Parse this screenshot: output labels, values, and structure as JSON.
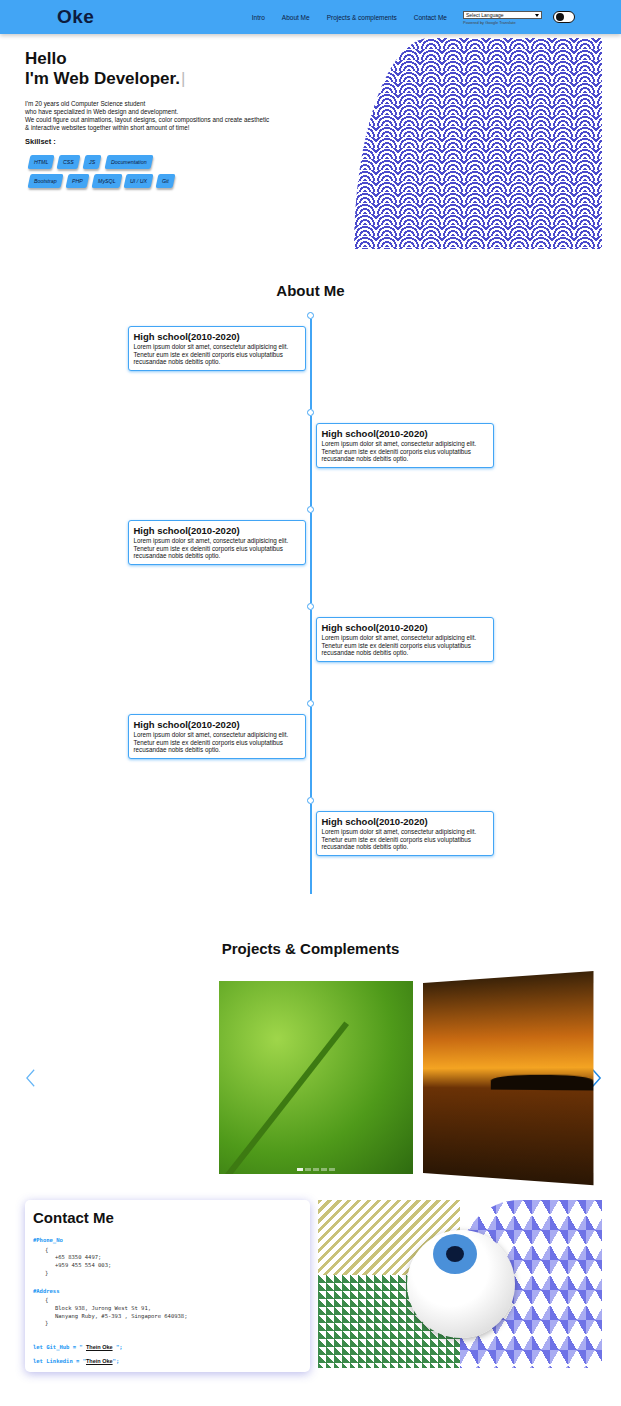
{
  "nav": {
    "logo": "Oke",
    "links": [
      "Intro",
      "About Me",
      "Projects & complements",
      "Contact Me"
    ],
    "language_select": "Select Language",
    "powered_by": "Powered by Google Translate",
    "dark_mode": false
  },
  "hero": {
    "greeting": "Hello",
    "title": "I'm Web Developer.",
    "cursor": "|",
    "intro": [
      "I'm 20 years old Computer Science student",
      "who have specialized in Web design and development.",
      "We could figure out animations, layout designs, color compositions and create aesthetic",
      "& interactive websites together within short amount of time!"
    ],
    "skillset_label": "Skillset :",
    "skills": [
      [
        "HTML",
        "CSS",
        "JS",
        "Documentation"
      ],
      [
        "Bootstrap",
        "PHP",
        "MySQL",
        "UI / UX",
        "Git"
      ]
    ]
  },
  "about": {
    "title": "About Me",
    "timeline": [
      {
        "title": "High school(2010-2020)",
        "text": "Lorem ipsum dolor sit amet, consectetur adipisicing elit. Tenetur eum iste ex deleniti corporis eius voluptatibus recusandae nobis debitis optio."
      },
      {
        "title": "High school(2010-2020)",
        "text": "Lorem ipsum dolor sit amet, consectetur adipisicing elit. Tenetur eum iste ex deleniti corporis eius voluptatibus recusandae nobis debitis optio."
      },
      {
        "title": "High school(2010-2020)",
        "text": "Lorem ipsum dolor sit amet, consectetur adipisicing elit. Tenetur eum iste ex deleniti corporis eius voluptatibus recusandae nobis debitis optio."
      },
      {
        "title": "High school(2010-2020)",
        "text": "Lorem ipsum dolor sit amet, consectetur adipisicing elit. Tenetur eum iste ex deleniti corporis eius voluptatibus recusandae nobis debitis optio."
      },
      {
        "title": "High school(2010-2020)",
        "text": "Lorem ipsum dolor sit amet, consectetur adipisicing elit. Tenetur eum iste ex deleniti corporis eius voluptatibus recusandae nobis debitis optio."
      },
      {
        "title": "High school(2010-2020)",
        "text": "Lorem ipsum dolor sit amet, consectetur adipisicing elit. Tenetur eum iste ex deleniti corporis eius voluptatibus recusandae nobis debitis optio."
      }
    ]
  },
  "projects": {
    "title": "Projects & Complements",
    "indicators": [
      {
        "selected": true
      },
      {
        "selected": false
      },
      {
        "selected": false
      },
      {
        "selected": false
      },
      {
        "selected": false
      }
    ]
  },
  "contact": {
    "title": "Contact Me",
    "blocks": [
      {
        "label": "#Phone_No",
        "open": "{",
        "lines": [
          "+65 8350 4497;",
          "+959 455 554 003;"
        ],
        "close": "}"
      },
      {
        "label": "#Address",
        "open": "{",
        "lines": [
          "Block 938, Jurong West St 91,",
          "Nanyang Ruby, #5-393 , Singapore 640938;"
        ],
        "close": "}"
      }
    ],
    "links": [
      {
        "prefix": "let Git_Hub = \" ",
        "name": "Thein Oke",
        "suffix": " \";"
      },
      {
        "prefix": "let Linkedin = \"",
        "name": "Thein Oke",
        "suffix": "\";"
      }
    ]
  }
}
